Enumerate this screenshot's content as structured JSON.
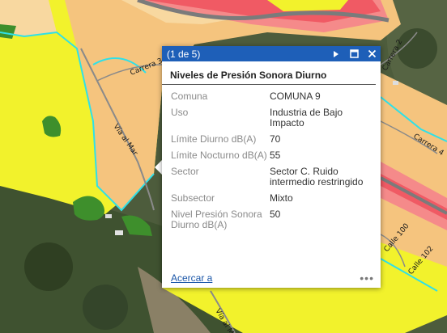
{
  "map": {
    "road_labels": [
      "Carrera 3",
      "Vía al Mar",
      "Carrera 2",
      "Carrera 4",
      "Calle 100",
      "Calle 102",
      "Vía al Mar"
    ],
    "colors": {
      "zone_yellow": "#f2f22c",
      "zone_orange": "#f5c47e",
      "zone_peach": "#f8d8a0",
      "zone_red": "#f05a64",
      "zone_pink": "#f58a8a",
      "zone_green": "#3e8f2c",
      "boundary_cyan": "#2fe0e8",
      "road_gray": "#7b7b7b"
    }
  },
  "popup": {
    "counter": "(1 de 5)",
    "title": "Niveles de Presión Sonora Diurno",
    "attributes": [
      {
        "label": "Comuna",
        "value": "COMUNA 9"
      },
      {
        "label": "Uso",
        "value": "Industria de Bajo Impacto"
      },
      {
        "label": "Límite Diurno dB(A)",
        "value": "70"
      },
      {
        "label": "Límite Nocturno dB(A)",
        "value": "55"
      },
      {
        "label": "Sector",
        "value": "Sector C. Ruido intermedio restringido"
      },
      {
        "label": "Subsector",
        "value": "Mixto"
      },
      {
        "label": "Nivel Presión Sonora Diurno dB(A)",
        "value": "50"
      }
    ],
    "zoom_link": "Acercar a",
    "more": "•••",
    "accent_color": "#1e5fb8",
    "icons": [
      "next-arrow-icon",
      "maximize-icon",
      "close-icon"
    ]
  }
}
